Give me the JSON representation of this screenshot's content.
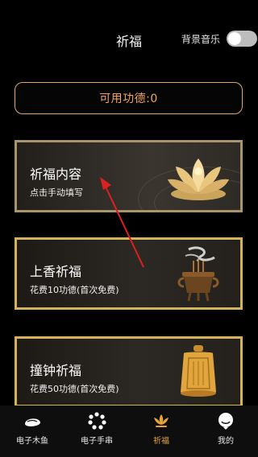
{
  "header": {
    "title": "祈福",
    "music_label": "背景音乐",
    "music_on": false
  },
  "merit": {
    "label": "可用功德:0"
  },
  "cards": [
    {
      "title": "祈福内容",
      "subtitle": "点击手动填写",
      "icon": "lotus-icon"
    },
    {
      "title": "上香祈福",
      "subtitle": "花费10功德(首次免费)",
      "icon": "incense-burner-icon"
    },
    {
      "title": "撞钟祈福",
      "subtitle": "花费50功德(首次免费)",
      "icon": "bell-icon"
    }
  ],
  "tabs": [
    {
      "label": "电子木鱼",
      "icon": "wooden-fish-icon",
      "active": false
    },
    {
      "label": "电子手串",
      "icon": "bead-bracelet-icon",
      "active": false
    },
    {
      "label": "祈福",
      "icon": "lotus-tab-icon",
      "active": true
    },
    {
      "label": "我的",
      "icon": "profile-icon",
      "active": false
    }
  ],
  "colors": {
    "accent": "#e3a23e",
    "merit_text": "#f0a560",
    "card_border": "#d4b35c",
    "annotation_arrow": "#e02020"
  }
}
